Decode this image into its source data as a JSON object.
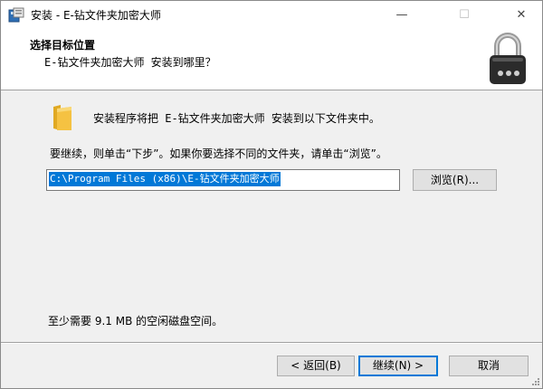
{
  "window": {
    "title": "安装 - E-钻文件夹加密大师",
    "minimize_glyph": "—",
    "maximize_glyph": "☐",
    "close_glyph": "✕",
    "icon": "installer-icon"
  },
  "header": {
    "title": "选择目标位置",
    "subtitle": "E-钻文件夹加密大师 安装到哪里？",
    "icon": "padlock-icon"
  },
  "body": {
    "folder_icon": "folder-icon",
    "intro": "安装程序将把 E-钻文件夹加密大师 安装到以下文件夹中。",
    "continue_text": "要继续，则单击“下步”。如果你要选择不同的文件夹，请单击“浏览”。",
    "path_value": "C:\\Program Files (x86)\\E-钻文件夹加密大师",
    "browse_label": "浏览(R)...",
    "space_required": "至少需要 9.1 MB 的空闲磁盘空间。"
  },
  "footer": {
    "back_label": "< 返回(B)",
    "next_label": "继续(N) >",
    "cancel_label": "取消"
  },
  "colors": {
    "accent": "#0078d7",
    "selection": "#0078d7",
    "folder": "#f5c242",
    "lock_body": "#2b2b2b"
  }
}
